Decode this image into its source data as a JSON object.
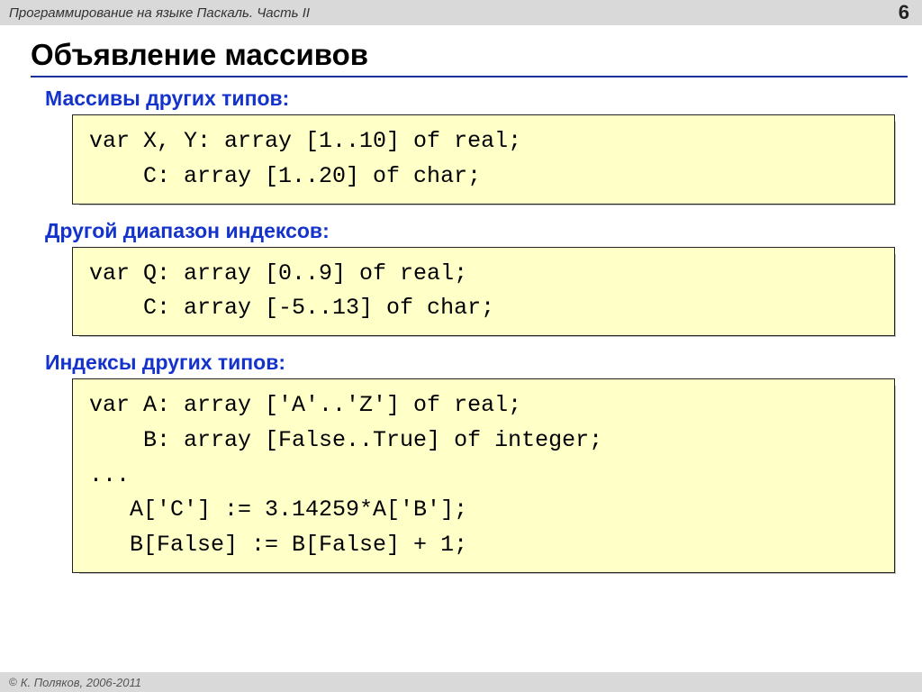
{
  "topbar": {
    "title": "Программирование на языке Паскаль. Часть II",
    "page_num": "6"
  },
  "heading": "Объявление массивов",
  "sections": [
    {
      "label": "Массивы других типов:",
      "code": "var X, Y: array [1..10] of real;\n    C: array [1..20] of char;"
    },
    {
      "label": "Другой диапазон индексов:",
      "code": "var Q: array [0..9] of real;\n    C: array [-5..13] of char;"
    },
    {
      "label": "Индексы других типов:",
      "code": "var A: array ['A'..'Z'] of real;\n    B: array [False..True] of integer;\n...\n   A['C'] := 3.14259*A['B'];\n   B[False] := B[False] + 1;"
    }
  ],
  "footer": {
    "copyright_symbol": "©",
    "text": "К. Поляков, 2006-2011"
  }
}
